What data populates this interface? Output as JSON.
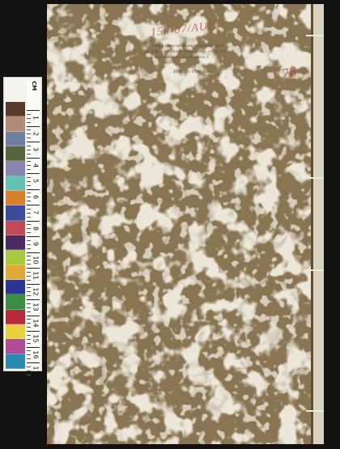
{
  "document": {
    "handwritten_call_number": "150-07/AUE",
    "handwritten_mark": "76",
    "library_stamp": {
      "line1": "THE CHINESE-JAPANESE LIBRARY",
      "line2": "OF THE HARVARD-YENCHING INSTITUTE",
      "line3": "AT HARVARD UNIVERSITY",
      "date": "JUN 16 1936"
    }
  },
  "color_target": {
    "unit": "CM",
    "scale": [
      "1",
      "2",
      "3",
      "4",
      "5",
      "6",
      "7",
      "8",
      "9",
      "10",
      "11",
      "12",
      "13",
      "14",
      "15",
      "16",
      "17"
    ],
    "patch_colors": [
      "#5a3a28",
      "#b08c78",
      "#6f7fa0",
      "#56663a",
      "#8886b0",
      "#66c0b4",
      "#d88030",
      "#3a4c9a",
      "#c04858",
      "#4a2a60",
      "#a8c840",
      "#e0a838",
      "#2c3590",
      "#3c8c44",
      "#b8283a",
      "#e8d040",
      "#b04c98",
      "#2c8ab0"
    ]
  },
  "colors": {
    "paper": "#8a7552",
    "marble_spots": "#d6cdb5",
    "background": "#141210"
  }
}
